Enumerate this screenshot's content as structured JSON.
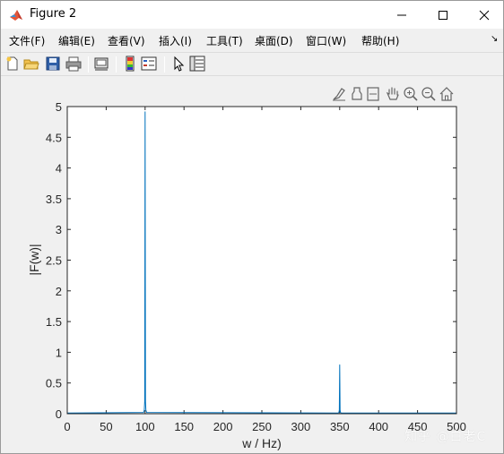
{
  "window": {
    "title": "Figure 2"
  },
  "menu": {
    "items": [
      "文件(F)",
      "编辑(E)",
      "查看(V)",
      "插入(I)",
      "工具(T)",
      "桌面(D)",
      "窗口(W)",
      "帮助(H)"
    ]
  },
  "toolbar": {
    "icons": [
      "new-figure-icon",
      "open-file-icon",
      "save-icon",
      "print-icon",
      "link-plot-icon",
      "colorbar-icon",
      "legend-icon",
      "edit-plot-arrow-icon",
      "property-inspector-icon"
    ]
  },
  "axes_toolbar": {
    "icons": [
      "brush-icon",
      "data-tips-icon",
      "rotate-icon",
      "pan-icon",
      "zoom-in-icon",
      "zoom-out-icon",
      "home-icon"
    ]
  },
  "watermark": "知乎 @白老C",
  "colors": {
    "line": "#0072bd",
    "axes_bg": "#ffffff",
    "figure_bg": "#f0f0f0"
  },
  "chart_data": {
    "type": "line",
    "title": "",
    "xlabel": "w / Hz)",
    "ylabel": "|F(w)|",
    "xlim": [
      0,
      500
    ],
    "ylim": [
      0,
      5
    ],
    "xticks": [
      0,
      50,
      100,
      150,
      200,
      250,
      300,
      350,
      400,
      450,
      500
    ],
    "yticks": [
      0,
      0.5,
      1,
      1.5,
      2,
      2.5,
      3,
      3.5,
      4,
      4.5,
      5
    ],
    "ytick_labels": [
      "0",
      "0.5",
      "1",
      "1.5",
      "2",
      "2.5",
      "3",
      "3.5",
      "4",
      "4.5",
      "5"
    ],
    "grid": false,
    "series": [
      {
        "x": [
          0,
          98,
          99,
          99.5,
          100,
          100.5,
          101,
          102,
          348,
          349,
          349.5,
          350,
          350.5,
          351,
          352,
          500
        ],
        "y": [
          0.01,
          0.02,
          0.06,
          0.2,
          4.92,
          0.2,
          0.06,
          0.02,
          0.01,
          0.02,
          0.06,
          0.8,
          0.06,
          0.02,
          0.01,
          0.01
        ]
      }
    ]
  }
}
